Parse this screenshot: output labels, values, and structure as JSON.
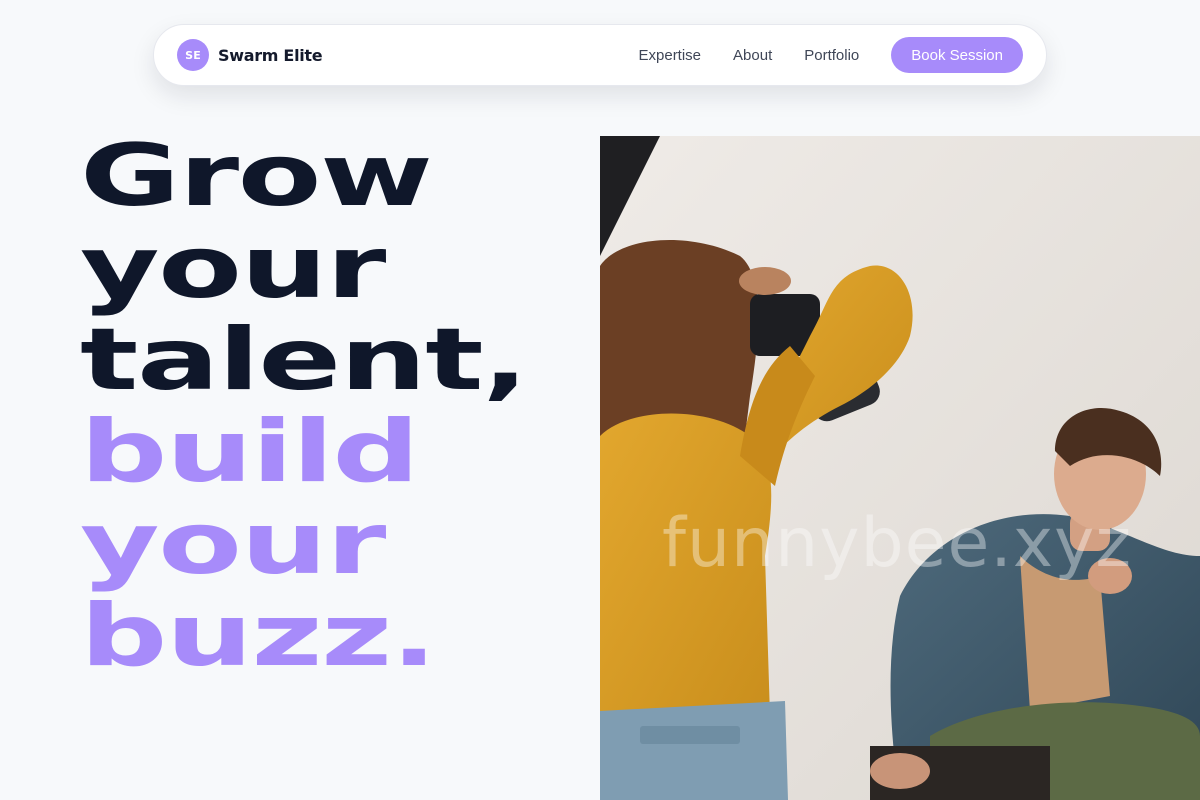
{
  "brand": {
    "initials": "SE",
    "name": "Swarm Elite"
  },
  "nav": {
    "links": [
      "Expertise",
      "About",
      "Portfolio"
    ],
    "cta_label": "Book Session"
  },
  "hero": {
    "lines_dark": [
      "Grow",
      "your",
      "talent,"
    ],
    "lines_accent": [
      "build",
      "your",
      "buzz."
    ]
  },
  "photo": {
    "watermark": "funnybee.xyz"
  },
  "colors": {
    "accent": "#a78bfa",
    "dark_text": "#0f172a",
    "background": "#f7f9fb"
  }
}
